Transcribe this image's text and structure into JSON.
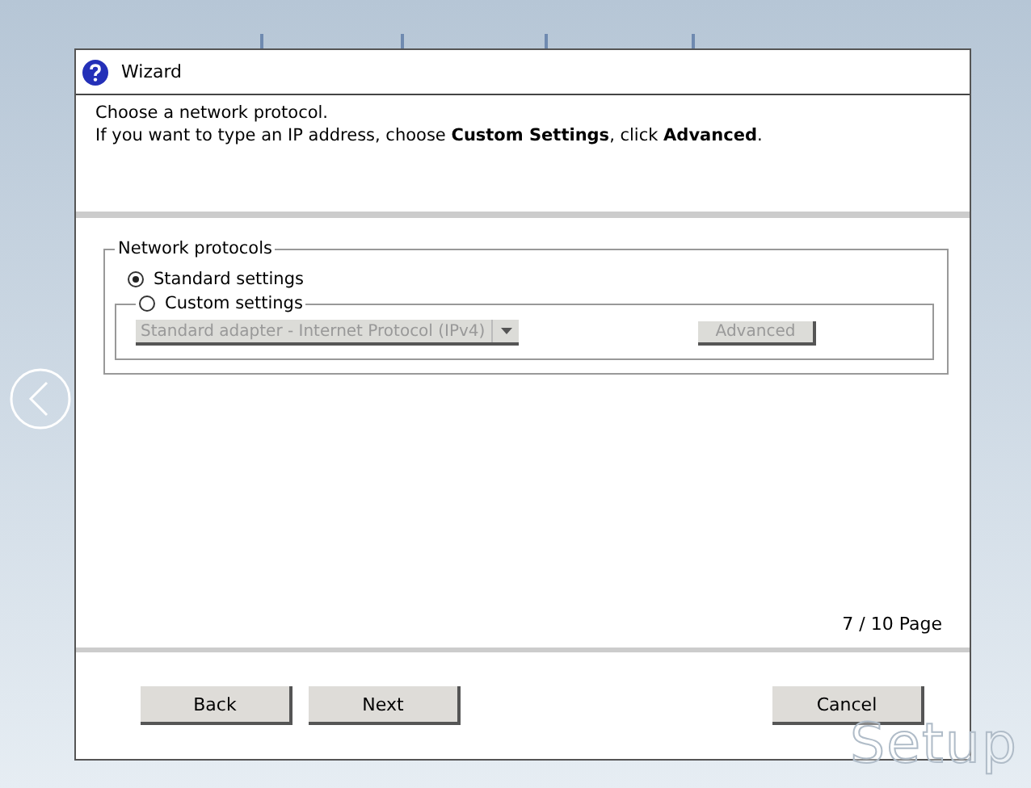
{
  "window": {
    "title": "Wizard"
  },
  "instructions": [
    "Choose a network protocol.",
    "If you want to type an IP address, choose **Custom Settings**, click **Advanced**."
  ],
  "group": {
    "title": "Network protocols",
    "options": [
      {
        "label": "Standard settings",
        "selected": true
      },
      {
        "label": "Custom settings",
        "selected": false
      }
    ],
    "adapter": {
      "value": "Standard adapter - Internet Protocol (IPv4)",
      "disabled": true
    },
    "advanced_button": {
      "label": "Advanced",
      "disabled": true
    }
  },
  "page_indicator": "7 / 10 Page",
  "buttons": [
    {
      "label": "Back",
      "kind": "left"
    },
    {
      "label": "Next",
      "kind": "left"
    },
    {
      "label": "Cancel",
      "kind": "right"
    }
  ],
  "background_title": "Setup"
}
